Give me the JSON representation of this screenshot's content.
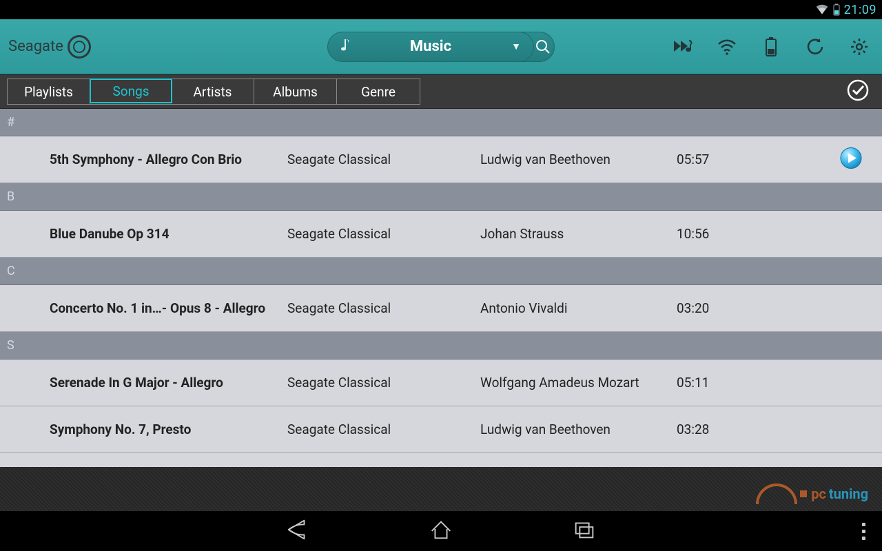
{
  "status": {
    "time": "21:09"
  },
  "brand": "Seagate",
  "selector": {
    "label": "Music"
  },
  "tabs": [
    "Playlists",
    "Songs",
    "Artists",
    "Albums",
    "Genre"
  ],
  "tabs_active_index": 1,
  "sections": [
    {
      "letter": "#",
      "rows": [
        {
          "title": "5th Symphony - Allegro Con Brio",
          "album": "Seagate Classical",
          "artist": "Ludwig van Beethoven",
          "duration": "05:57",
          "playing": true
        }
      ]
    },
    {
      "letter": "B",
      "rows": [
        {
          "title": "Blue Danube Op 314",
          "album": "Seagate Classical",
          "artist": "Johan Strauss",
          "duration": "10:56",
          "playing": false
        }
      ]
    },
    {
      "letter": "C",
      "rows": [
        {
          "title": "Concerto No. 1 in…- Opus 8 - Allegro",
          "album": "Seagate Classical",
          "artist": "Antonio Vivaldi",
          "duration": "03:20",
          "playing": false
        }
      ]
    },
    {
      "letter": "S",
      "rows": [
        {
          "title": "Serenade In G Major - Allegro",
          "album": "Seagate Classical",
          "artist": "Wolfgang Amadeus Mozart",
          "duration": "05:11",
          "playing": false
        },
        {
          "title": "Symphony No. 7, Presto",
          "album": "Seagate Classical",
          "artist": "Ludwig van Beethoven",
          "duration": "03:28",
          "playing": false
        }
      ]
    }
  ],
  "watermark": {
    "part1": "pc",
    "part2": "tuning"
  }
}
